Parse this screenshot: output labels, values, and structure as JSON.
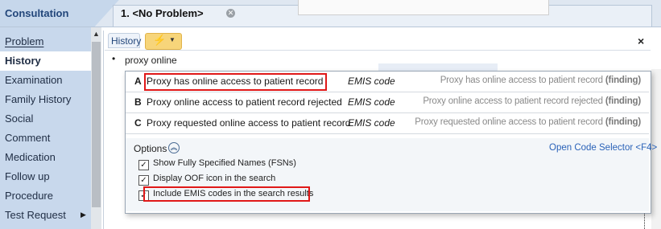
{
  "header": {
    "section_title": "Consultation",
    "tab_title": "1. <No Problem>",
    "tab_close_icon": "close-circle-icon"
  },
  "sidebar": {
    "items": [
      {
        "label": "Problem",
        "active": false
      },
      {
        "label": "History",
        "active": true
      },
      {
        "label": "Examination",
        "active": false
      },
      {
        "label": "Family History",
        "active": false
      },
      {
        "label": "Social",
        "active": false
      },
      {
        "label": "Comment",
        "active": false
      },
      {
        "label": "Medication",
        "active": false
      },
      {
        "label": "Follow up",
        "active": false
      },
      {
        "label": "Procedure",
        "active": false
      },
      {
        "label": "Test Request",
        "active": false
      }
    ]
  },
  "history": {
    "tab_label": "History",
    "close_symbol": "×",
    "bullet": "•",
    "query": "proxy online"
  },
  "results": [
    {
      "letter": "A",
      "term": "Proxy has online access to patient record",
      "source": "EMIS code",
      "fsn": "Proxy has online access to patient record",
      "fsn_tag": "(finding)"
    },
    {
      "letter": "B",
      "term": "Proxy online access to patient record rejected",
      "source": "EMIS code",
      "fsn": "Proxy online access to patient record rejected",
      "fsn_tag": "(finding)"
    },
    {
      "letter": "C",
      "term": "Proxy requested online access to patient record",
      "source": "EMIS code",
      "fsn": "Proxy requested online access to patient record",
      "fsn_tag": "(finding)"
    }
  ],
  "options": {
    "label": "Options",
    "open_code_selector": "Open Code Selector <F4>",
    "checkboxes": [
      {
        "label": "Show Fully Specified Names (FSNs)",
        "checked": true
      },
      {
        "label": "Display OOF icon in the search",
        "checked": true
      },
      {
        "label": "Include EMIS codes in the search results",
        "checked": true
      }
    ]
  },
  "colors": {
    "highlight": "#e01818",
    "sidebar_bg": "#c8d8ec",
    "link": "#2a62b8",
    "title": "#22467a"
  }
}
